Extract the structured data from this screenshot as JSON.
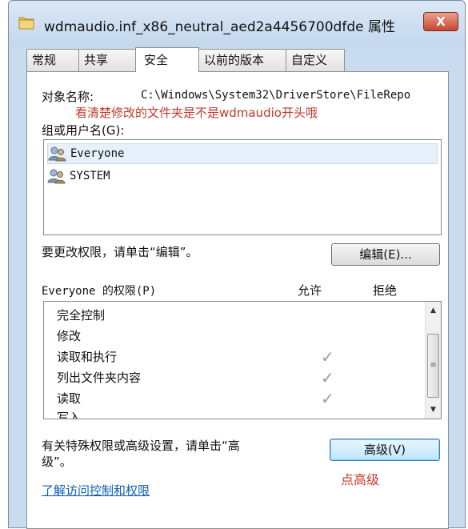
{
  "window": {
    "title": "wdmaudio.inf_x86_neutral_aed2a4456700dfde 属性",
    "close_label": "X"
  },
  "tabs": [
    {
      "label": "常规",
      "active": false
    },
    {
      "label": "共享",
      "active": false
    },
    {
      "label": "安全",
      "active": true
    },
    {
      "label": "以前的版本",
      "active": false
    },
    {
      "label": "自定义",
      "active": false
    }
  ],
  "security": {
    "object_name_label": "对象名称:",
    "object_name_value": "C:\\Windows\\System32\\DriverStore\\FileRepo",
    "annotation_folder": "看清楚修改的文件夹是不是wdmaudio开头哦",
    "groups_label": "组或用户名(G):",
    "users": [
      {
        "name": "Everyone",
        "selected": true
      },
      {
        "name": "SYSTEM",
        "selected": false
      }
    ],
    "change_hint": "要更改权限，请单击“编辑”。",
    "edit_button": "编辑(E)...",
    "permissions_label": "Everyone 的权限(P)",
    "allow_header": "允许",
    "deny_header": "拒绝",
    "permissions": [
      {
        "name": "完全控制",
        "allow": false
      },
      {
        "name": "修改",
        "allow": false
      },
      {
        "name": "读取和执行",
        "allow": true
      },
      {
        "name": "列出文件夹内容",
        "allow": true
      },
      {
        "name": "读取",
        "allow": true
      },
      {
        "name": "写入",
        "allow": false
      }
    ],
    "advanced_hint_line1": "有关特殊权限或高级设置，请单击“高",
    "advanced_hint_line2": "级”。",
    "advanced_button": "高级(V)",
    "annotation_advanced": "点高级",
    "learn_link": "了解访问控制和权限"
  },
  "icons": {
    "folder": "folder-icon",
    "user": "users-icon",
    "check": "✓"
  },
  "colors": {
    "annotation": "#c0392b",
    "link": "#0d5fb3",
    "window_frame": "#c9dcef"
  }
}
